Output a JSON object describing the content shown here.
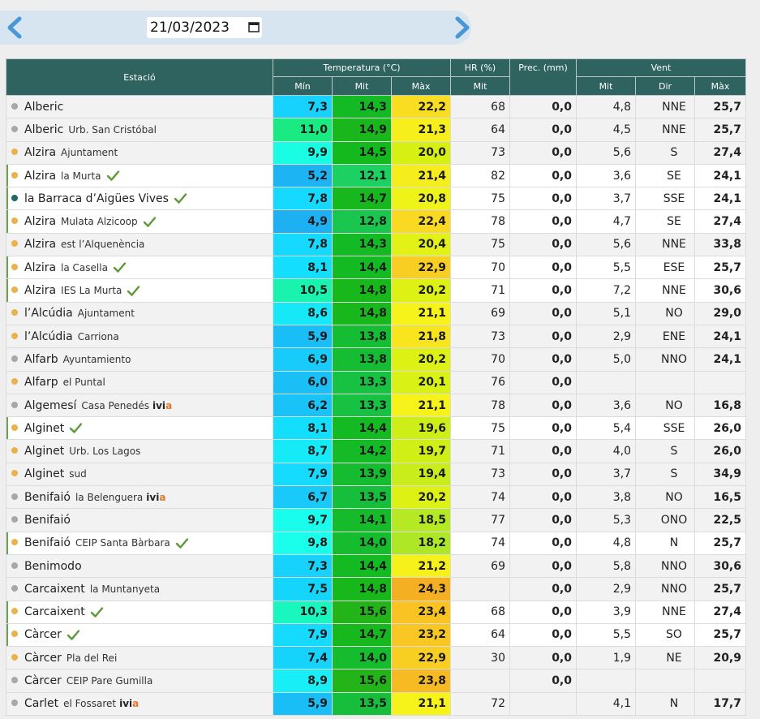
{
  "date_nav": {
    "date_value": "21/03/2023",
    "prev_icon": "chevron-left-icon",
    "next_icon": "chevron-right-icon",
    "calendar_icon": "calendar-icon",
    "accent": "#4a96d6"
  },
  "table": {
    "header": {
      "station": "Estació",
      "temperature": "Temperatura (°C)",
      "humidity": "HR (%)",
      "precipitation": "Prec. (mm)",
      "wind": "Vent",
      "t_min": "Mín",
      "t_avg": "Mit",
      "t_max": "Màx",
      "hr_avg": "Mit",
      "w_avg": "Mit",
      "w_dir": "Dir",
      "w_max": "Màx"
    },
    "colors": {
      "header_bg": "#2e6360",
      "dot_orange": "#ecb248",
      "dot_gray": "#a8a8a8",
      "dot_teal": "#1e6b64",
      "check_green": "#5a9a35",
      "ivia_accent": "#e4762a"
    },
    "rows": [
      {
        "name": "Alberic",
        "sub": "",
        "ivia": false,
        "validated": false,
        "dot": "gray",
        "tmin": "7,3",
        "tavg": "14,3",
        "tmax": "22,2",
        "hr": "68",
        "prec": "0,0",
        "wavg": "4,8",
        "wdir": "NNE",
        "wmax": "25,7"
      },
      {
        "name": "Alberic",
        "sub": "Urb. San Cristóbal",
        "ivia": false,
        "validated": false,
        "dot": "gray",
        "tmin": "11,0",
        "tavg": "14,9",
        "tmax": "21,3",
        "hr": "64",
        "prec": "0,0",
        "wavg": "4,5",
        "wdir": "NNE",
        "wmax": "25,7"
      },
      {
        "name": "Alzira",
        "sub": "Ajuntament",
        "ivia": false,
        "validated": false,
        "dot": "orange",
        "tmin": "9,9",
        "tavg": "14,5",
        "tmax": "20,0",
        "hr": "73",
        "prec": "0,0",
        "wavg": "5,6",
        "wdir": "S",
        "wmax": "27,4"
      },
      {
        "name": "Alzira",
        "sub": "la Murta",
        "ivia": false,
        "validated": true,
        "dot": "orange",
        "tmin": "5,2",
        "tavg": "12,1",
        "tmax": "21,4",
        "hr": "82",
        "prec": "0,0",
        "wavg": "3,6",
        "wdir": "SE",
        "wmax": "24,1"
      },
      {
        "name": "la Barraca d’Aigües Vives",
        "sub": "",
        "ivia": false,
        "validated": true,
        "dot": "teal",
        "tmin": "7,8",
        "tavg": "14,7",
        "tmax": "20,8",
        "hr": "75",
        "prec": "0,0",
        "wavg": "3,7",
        "wdir": "SSE",
        "wmax": "24,1"
      },
      {
        "name": "Alzira",
        "sub": "Mulata Alzicoop",
        "ivia": false,
        "validated": true,
        "dot": "orange",
        "tmin": "4,9",
        "tavg": "12,8",
        "tmax": "22,4",
        "hr": "78",
        "prec": "0,0",
        "wavg": "4,7",
        "wdir": "SE",
        "wmax": "27,4"
      },
      {
        "name": "Alzira",
        "sub": "est l’Alquenència",
        "ivia": false,
        "validated": false,
        "dot": "orange",
        "tmin": "7,8",
        "tavg": "14,3",
        "tmax": "20,4",
        "hr": "75",
        "prec": "0,0",
        "wavg": "5,6",
        "wdir": "NNE",
        "wmax": "33,8"
      },
      {
        "name": "Alzira",
        "sub": "la Casella",
        "ivia": false,
        "validated": true,
        "dot": "orange",
        "tmin": "8,1",
        "tavg": "14,4",
        "tmax": "22,9",
        "hr": "70",
        "prec": "0,0",
        "wavg": "5,5",
        "wdir": "ESE",
        "wmax": "25,7"
      },
      {
        "name": "Alzira",
        "sub": "IES La Murta",
        "ivia": false,
        "validated": true,
        "dot": "orange",
        "tmin": "10,5",
        "tavg": "14,8",
        "tmax": "20,2",
        "hr": "71",
        "prec": "0,0",
        "wavg": "7,2",
        "wdir": "NNE",
        "wmax": "30,6"
      },
      {
        "name": "l’Alcúdia",
        "sub": "Ajuntament",
        "ivia": false,
        "validated": false,
        "dot": "orange",
        "tmin": "8,6",
        "tavg": "14,8",
        "tmax": "21,1",
        "hr": "69",
        "prec": "0,0",
        "wavg": "5,1",
        "wdir": "NO",
        "wmax": "29,0"
      },
      {
        "name": "l’Alcúdia",
        "sub": "Carriona",
        "ivia": false,
        "validated": false,
        "dot": "orange",
        "tmin": "5,9",
        "tavg": "13,8",
        "tmax": "21,8",
        "hr": "73",
        "prec": "0,0",
        "wavg": "2,9",
        "wdir": "ENE",
        "wmax": "24,1"
      },
      {
        "name": "Alfarb",
        "sub": "Ayuntamiento",
        "ivia": false,
        "validated": false,
        "dot": "gray",
        "tmin": "6,9",
        "tavg": "13,8",
        "tmax": "20,2",
        "hr": "70",
        "prec": "0,0",
        "wavg": "5,0",
        "wdir": "NNO",
        "wmax": "24,1"
      },
      {
        "name": "Alfarp",
        "sub": "el Puntal",
        "ivia": false,
        "validated": false,
        "dot": "orange",
        "tmin": "6,0",
        "tavg": "13,3",
        "tmax": "20,1",
        "hr": "76",
        "prec": "0,0",
        "wavg": "",
        "wdir": "",
        "wmax": ""
      },
      {
        "name": "Algemesí",
        "sub": "Casa Penedés",
        "ivia": true,
        "validated": false,
        "dot": "gray",
        "tmin": "6,2",
        "tavg": "13,3",
        "tmax": "21,1",
        "hr": "78",
        "prec": "0,0",
        "wavg": "3,6",
        "wdir": "NO",
        "wmax": "16,8"
      },
      {
        "name": "Alginet",
        "sub": "",
        "ivia": false,
        "validated": true,
        "dot": "orange",
        "tmin": "8,1",
        "tavg": "14,4",
        "tmax": "19,6",
        "hr": "75",
        "prec": "0,0",
        "wavg": "5,4",
        "wdir": "SSE",
        "wmax": "26,0"
      },
      {
        "name": "Alginet",
        "sub": "Urb. Los Lagos",
        "ivia": false,
        "validated": false,
        "dot": "orange",
        "tmin": "8,7",
        "tavg": "14,2",
        "tmax": "19,7",
        "hr": "71",
        "prec": "0,0",
        "wavg": "4,0",
        "wdir": "S",
        "wmax": "26,0"
      },
      {
        "name": "Alginet",
        "sub": "sud",
        "ivia": false,
        "validated": false,
        "dot": "orange",
        "tmin": "7,9",
        "tavg": "13,9",
        "tmax": "19,4",
        "hr": "73",
        "prec": "0,0",
        "wavg": "3,7",
        "wdir": "S",
        "wmax": "34,9"
      },
      {
        "name": "Benifaió",
        "sub": "la Belenguera",
        "ivia": true,
        "validated": false,
        "dot": "gray",
        "tmin": "6,7",
        "tavg": "13,5",
        "tmax": "20,2",
        "hr": "74",
        "prec": "0,0",
        "wavg": "3,8",
        "wdir": "NO",
        "wmax": "16,5"
      },
      {
        "name": "Benifaió",
        "sub": "",
        "ivia": false,
        "validated": false,
        "dot": "gray",
        "tmin": "9,7",
        "tavg": "14,1",
        "tmax": "18,5",
        "hr": "77",
        "prec": "0,0",
        "wavg": "5,3",
        "wdir": "ONO",
        "wmax": "22,5"
      },
      {
        "name": "Benifaió",
        "sub": "CEIP Santa Bàrbara",
        "ivia": false,
        "validated": true,
        "dot": "orange",
        "tmin": "9,8",
        "tavg": "14,0",
        "tmax": "18,2",
        "hr": "74",
        "prec": "0,0",
        "wavg": "4,8",
        "wdir": "N",
        "wmax": "25,7"
      },
      {
        "name": "Benimodo",
        "sub": "",
        "ivia": false,
        "validated": false,
        "dot": "gray",
        "tmin": "7,3",
        "tavg": "14,4",
        "tmax": "21,2",
        "hr": "69",
        "prec": "0,0",
        "wavg": "5,8",
        "wdir": "NNO",
        "wmax": "30,6"
      },
      {
        "name": "Carcaixent",
        "sub": "la Muntanyeta",
        "ivia": false,
        "validated": false,
        "dot": "gray",
        "tmin": "7,5",
        "tavg": "14,8",
        "tmax": "24,3",
        "hr": "",
        "prec": "0,0",
        "wavg": "2,9",
        "wdir": "NNO",
        "wmax": "25,7"
      },
      {
        "name": "Carcaixent",
        "sub": "",
        "ivia": false,
        "validated": true,
        "dot": "orange",
        "tmin": "10,3",
        "tavg": "15,6",
        "tmax": "23,4",
        "hr": "68",
        "prec": "0,0",
        "wavg": "3,9",
        "wdir": "NNE",
        "wmax": "27,4"
      },
      {
        "name": "Càrcer",
        "sub": "",
        "ivia": false,
        "validated": true,
        "dot": "orange",
        "tmin": "7,9",
        "tavg": "14,7",
        "tmax": "23,2",
        "hr": "64",
        "prec": "0,0",
        "wavg": "5,5",
        "wdir": "SO",
        "wmax": "25,7"
      },
      {
        "name": "Càrcer",
        "sub": "Pla del Rei",
        "ivia": false,
        "validated": false,
        "dot": "orange",
        "tmin": "7,4",
        "tavg": "14,0",
        "tmax": "22,9",
        "hr": "30",
        "prec": "0,0",
        "wavg": "1,9",
        "wdir": "NE",
        "wmax": "20,9"
      },
      {
        "name": "Càrcer",
        "sub": "CEIP Pare Gumilla",
        "ivia": false,
        "validated": false,
        "dot": "gray",
        "tmin": "8,9",
        "tavg": "15,6",
        "tmax": "23,8",
        "hr": "",
        "prec": "0,0",
        "wavg": "",
        "wdir": "",
        "wmax": ""
      },
      {
        "name": "Carlet",
        "sub": "el Fossaret",
        "ivia": true,
        "validated": false,
        "dot": "gray",
        "tmin": "5,9",
        "tavg": "13,5",
        "tmax": "21,1",
        "hr": "72",
        "prec": "",
        "wavg": "4,1",
        "wdir": "N",
        "wmax": "17,7"
      }
    ]
  }
}
